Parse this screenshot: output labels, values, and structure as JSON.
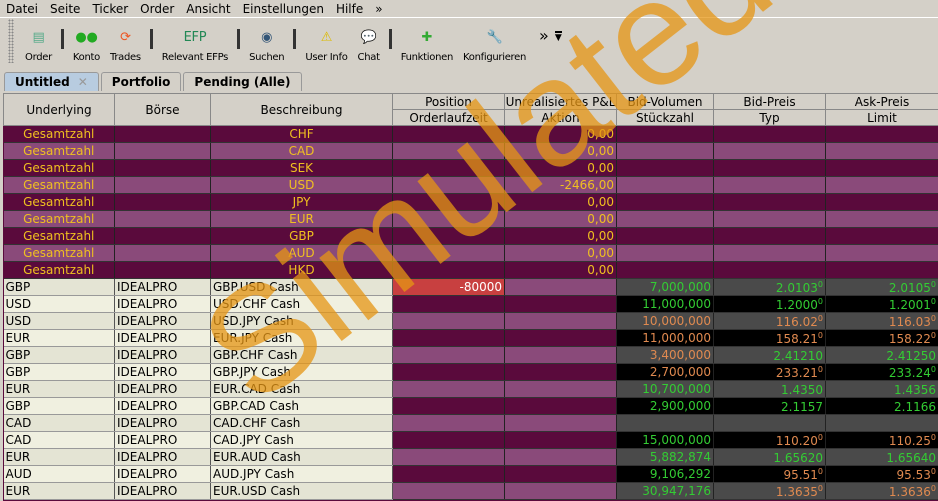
{
  "menu": [
    "Datei",
    "Seite",
    "Ticker",
    "Order",
    "Ansicht",
    "Einstellungen",
    "Hilfe",
    "»"
  ],
  "toolbar": [
    {
      "label": "Order",
      "icon": "order-icon",
      "glyph": "▤",
      "color": "#5a8"
    },
    {
      "label": "Konto",
      "icon": "account-icon",
      "glyph": "●●",
      "color": "#2a2"
    },
    {
      "label": "Trades",
      "icon": "trades-icon",
      "glyph": "⟳",
      "color": "#e52"
    },
    {
      "label": "Relevant EFPs",
      "icon": "efp-icon",
      "glyph": "EFP",
      "color": "#285"
    },
    {
      "label": "Suchen",
      "icon": "search-icon",
      "glyph": "◉",
      "color": "#357"
    },
    {
      "label": "User Info",
      "icon": "warning-icon",
      "glyph": "⚠",
      "color": "#db0"
    },
    {
      "label": "Chat",
      "icon": "chat-icon",
      "glyph": "💬",
      "color": "#99c"
    },
    {
      "label": "Funktionen",
      "icon": "functions-icon",
      "glyph": "✚",
      "color": "#3a3"
    },
    {
      "label": "Konfigurieren",
      "icon": "wrench-icon",
      "glyph": "🔧",
      "color": "#999"
    }
  ],
  "toolbar_more": "»",
  "tabs": [
    {
      "label": "Untitled",
      "active": true
    },
    {
      "label": "Portfolio"
    },
    {
      "label": "Pending (Alle)"
    }
  ],
  "headers": {
    "underlying": "Underlying",
    "boerse": "Börse",
    "beschreibung": "Beschreibung",
    "position": "Position",
    "orderlaufzeit": "Orderlaufzeit",
    "pnl": "Unrealisiertes P&L",
    "aktion": "Aktion",
    "bidvol": "Bid-Volumen",
    "stueck": "Stückzahl",
    "bid": "Bid-Preis",
    "typ": "Typ",
    "ask": "Ask-Preis",
    "limit": "Limit"
  },
  "summary": [
    {
      "label": "Gesamtzahl",
      "cur": "CHF",
      "pnl": "0,00"
    },
    {
      "label": "Gesamtzahl",
      "cur": "CAD",
      "pnl": "0,00"
    },
    {
      "label": "Gesamtzahl",
      "cur": "SEK",
      "pnl": "0,00"
    },
    {
      "label": "Gesamtzahl",
      "cur": "USD",
      "pnl": "-2466,00"
    },
    {
      "label": "Gesamtzahl",
      "cur": "JPY",
      "pnl": "0,00"
    },
    {
      "label": "Gesamtzahl",
      "cur": "EUR",
      "pnl": "0,00"
    },
    {
      "label": "Gesamtzahl",
      "cur": "GBP",
      "pnl": "0,00"
    },
    {
      "label": "Gesamtzahl",
      "cur": "AUD",
      "pnl": "0,00"
    },
    {
      "label": "Gesamtzahl",
      "cur": "HKD",
      "pnl": "0,00"
    }
  ],
  "rows": [
    {
      "u": "GBP",
      "x": "IDEALPRO",
      "d": "GBP.USD Cash",
      "pos": "-80000",
      "vol": "7,000,000",
      "vc": "g",
      "bid": "2.0103",
      "bs": "0",
      "bc": "g",
      "ask": "2.0105",
      "as": "0",
      "ac": "g"
    },
    {
      "u": "USD",
      "x": "IDEALPRO",
      "d": "USD.CHF Cash",
      "pos": "",
      "vol": "11,000,000",
      "vc": "g",
      "bid": "1.2000",
      "bs": "0",
      "bc": "g",
      "ask": "1.2001",
      "as": "0",
      "ac": "g"
    },
    {
      "u": "USD",
      "x": "IDEALPRO",
      "d": "USD.JPY Cash",
      "pos": "",
      "vol": "10,000,000",
      "vc": "o",
      "bid": "116.02",
      "bs": "0",
      "bc": "o",
      "ask": "116.03",
      "as": "0",
      "ac": "o"
    },
    {
      "u": "EUR",
      "x": "IDEALPRO",
      "d": "EUR.JPY Cash",
      "pos": "",
      "vol": "11,000,000",
      "vc": "o",
      "bid": "158.21",
      "bs": "0",
      "bc": "o",
      "ask": "158.22",
      "as": "0",
      "ac": "o"
    },
    {
      "u": "GBP",
      "x": "IDEALPRO",
      "d": "GBP.CHF Cash",
      "pos": "",
      "vol": "3,400,000",
      "vc": "o",
      "bid": "2.41210",
      "bs": "",
      "bc": "g",
      "ask": "2.41250",
      "as": "",
      "ac": "g"
    },
    {
      "u": "GBP",
      "x": "IDEALPRO",
      "d": "GBP.JPY Cash",
      "pos": "",
      "vol": "2,700,000",
      "vc": "o",
      "bid": "233.21",
      "bs": "0",
      "bc": "o",
      "ask": "233.24",
      "as": "0",
      "ac": "g"
    },
    {
      "u": "EUR",
      "x": "IDEALPRO",
      "d": "EUR.CAD Cash",
      "pos": "",
      "vol": "10,700,000",
      "vc": "g",
      "bid": "1.4350",
      "bs": "",
      "bc": "g",
      "ask": "1.4356",
      "as": "",
      "ac": "g"
    },
    {
      "u": "GBP",
      "x": "IDEALPRO",
      "d": "GBP.CAD Cash",
      "pos": "",
      "vol": "2,900,000",
      "vc": "g",
      "bid": "2.1157",
      "bs": "",
      "bc": "g",
      "ask": "2.1166",
      "as": "",
      "ac": "g"
    },
    {
      "u": "CAD",
      "x": "IDEALPRO",
      "d": "CAD.CHF Cash",
      "pos": "",
      "vol": "",
      "vc": "g",
      "bid": "",
      "bs": "",
      "bc": "g",
      "ask": "",
      "as": "",
      "ac": "g"
    },
    {
      "u": "CAD",
      "x": "IDEALPRO",
      "d": "CAD.JPY Cash",
      "pos": "",
      "vol": "15,000,000",
      "vc": "g",
      "bid": "110.20",
      "bs": "0",
      "bc": "o",
      "ask": "110.25",
      "as": "0",
      "ac": "o"
    },
    {
      "u": "EUR",
      "x": "IDEALPRO",
      "d": "EUR.AUD Cash",
      "pos": "",
      "vol": "5,882,874",
      "vc": "g",
      "bid": "1.65620",
      "bs": "",
      "bc": "g",
      "ask": "1.65640",
      "as": "",
      "ac": "g"
    },
    {
      "u": "AUD",
      "x": "IDEALPRO",
      "d": "AUD.JPY Cash",
      "pos": "",
      "vol": "9,106,292",
      "vc": "g",
      "bid": "95.51",
      "bs": "0",
      "bc": "o",
      "ask": "95.53",
      "as": "0",
      "ac": "o"
    },
    {
      "u": "EUR",
      "x": "IDEALPRO",
      "d": "EUR.USD Cash",
      "pos": "",
      "vol": "30,947,176",
      "vc": "g",
      "bid": "1.3635",
      "bs": "0",
      "bc": "o",
      "ask": "1.3636",
      "as": "0",
      "ac": "o"
    }
  ],
  "watermark": "Simulated Trading"
}
